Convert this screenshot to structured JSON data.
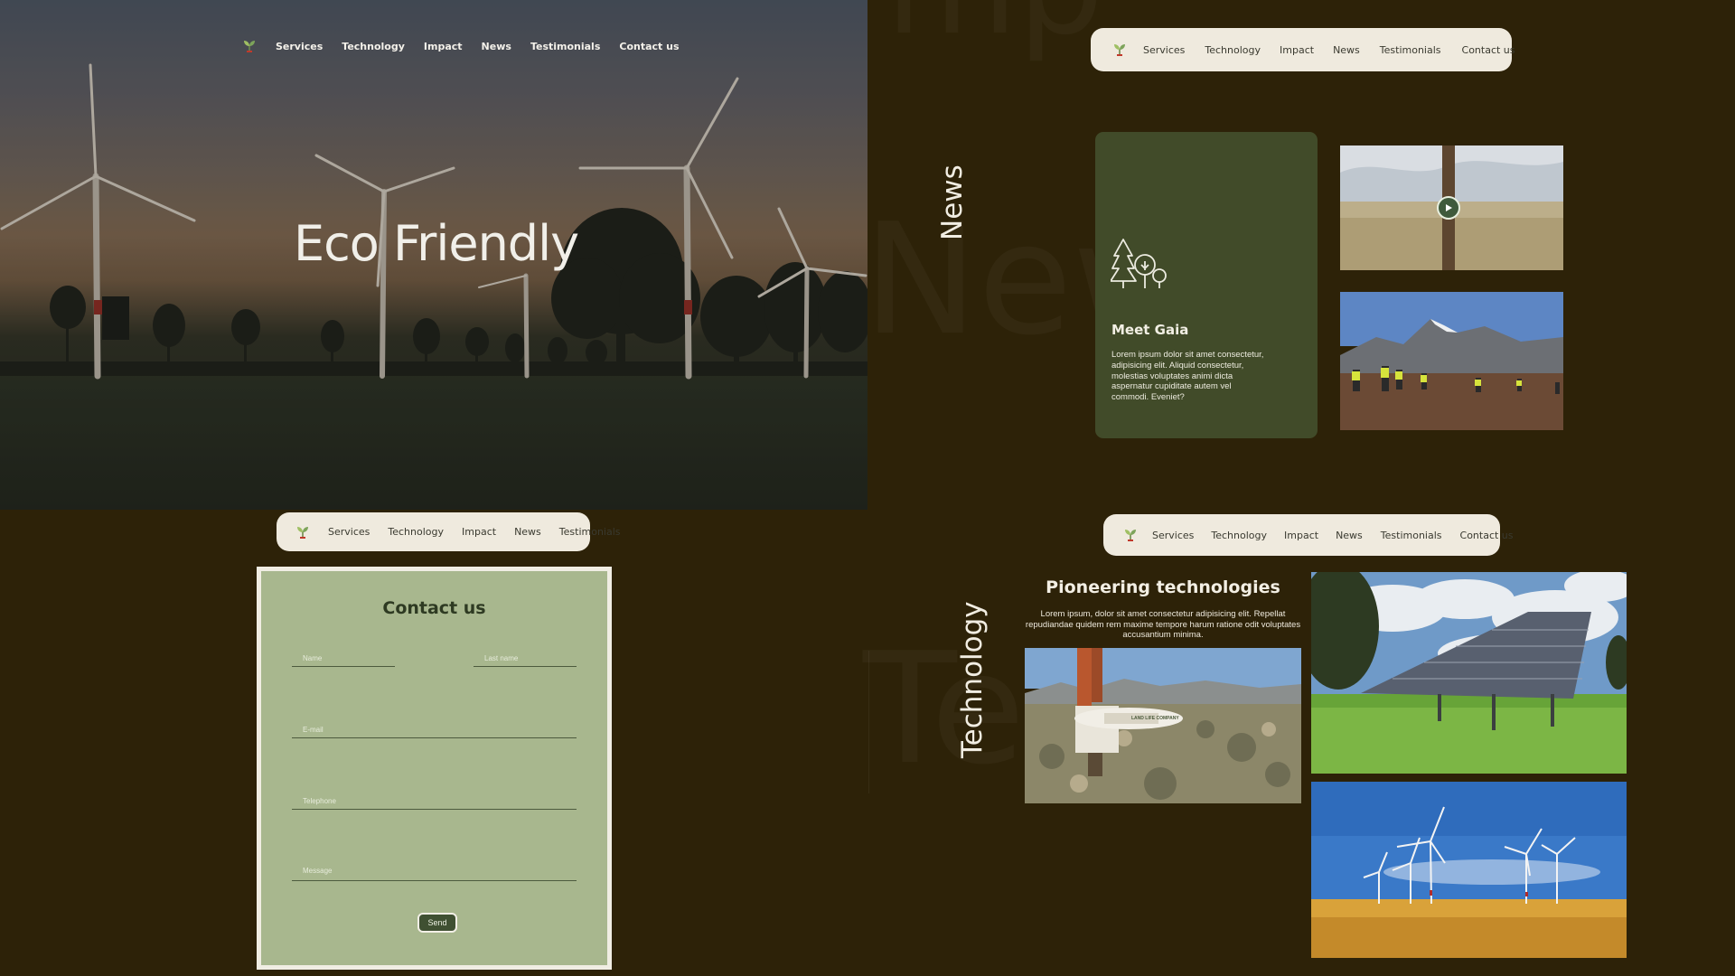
{
  "nav": {
    "links": [
      "Services",
      "Technology",
      "Impact",
      "News",
      "Testimonials",
      "Contact us"
    ],
    "contact_nav_links": [
      "Services",
      "Technology",
      "Impact",
      "News",
      "Testimonials"
    ]
  },
  "hero": {
    "title": "Eco Friendly"
  },
  "contact": {
    "title": "Contact us",
    "name_placeholder": "Name",
    "last_name_placeholder": "Last name",
    "email_placeholder": "E-mail",
    "telephone_placeholder": "Telephone",
    "message_placeholder": "Message",
    "send_label": "Send"
  },
  "news": {
    "section_title": "News",
    "ghost_word": "News",
    "card_title": "Meet Gaia",
    "card_text": "Lorem ipsum dolor sit amet consectetur, adipisicing elit. Aliquid consectetur, molestias voluptates animi dicta aspernatur cupiditate autem vel commodi. Eveniet?"
  },
  "technology": {
    "section_title": "Technology",
    "ghost_word": "Te",
    "heading": "Pioneering technologies",
    "text": "Lorem ipsum, dolor sit amet consectetur adipisicing elit. Repellat repudiandae quidem rem maxime tempore harum ratione odit voluptates accusantium minima."
  },
  "ghost_top": "mp",
  "photo_labels": {
    "drill_brand": "LAND LIFE COMPANY"
  },
  "colors": {
    "background": "#2d2208",
    "card_green": "#414b29",
    "form_green": "#a8b78e",
    "nav_pill": "#efeade"
  }
}
